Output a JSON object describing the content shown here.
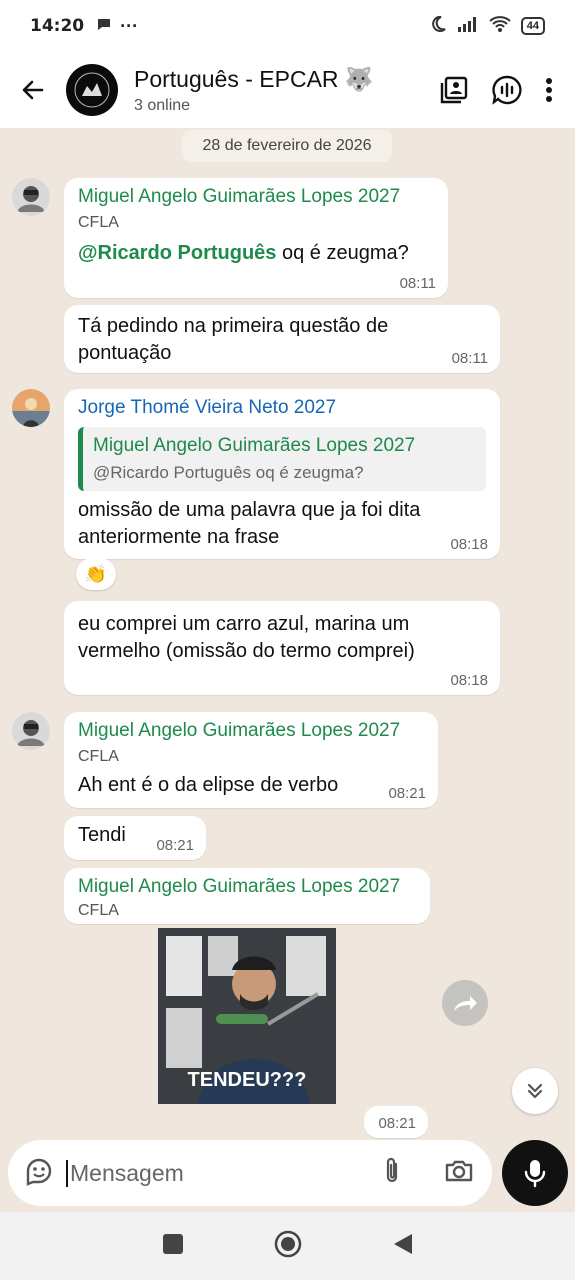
{
  "status_bar": {
    "time": "14:20",
    "battery": "44"
  },
  "header": {
    "title": "Português - EPCAR 🐺",
    "subtitle": "3 online"
  },
  "date_chip": "28 de fevereiro de 2026",
  "messages": [
    {
      "sender": "Miguel Angelo Guimarães Lopes 2027",
      "tag": "CFLA",
      "mention": "@Ricardo Português",
      "text": " oq é zeugma?",
      "time": "08:11"
    },
    {
      "text_line1": "Tá pedindo na primeira questão de",
      "text_line2": "pontuação",
      "time": "08:11"
    },
    {
      "sender": "Jorge Thomé Vieira Neto 2027",
      "quote_name": "Miguel Angelo Guimarães Lopes 2027",
      "quote_text": "@Ricardo Português oq é zeugma?",
      "text_line1": "omissão de uma palavra que ja foi dita",
      "text_line2": "anteriormente na frase",
      "time": "08:18",
      "reaction": "👏"
    },
    {
      "text_line1": "eu comprei um carro azul, marina um",
      "text_line2": "vermelho (omissão do termo comprei)",
      "time": "08:18"
    },
    {
      "sender": "Miguel Angelo Guimarães Lopes 2027",
      "tag": "CFLA",
      "text": "Ah ent é o da elipse de verbo",
      "time": "08:21"
    },
    {
      "text": "Tendi",
      "time": "08:21"
    },
    {
      "sender": "Miguel Angelo Guimarães Lopes 2027",
      "tag": "CFLA"
    },
    {
      "video_caption": "TENDEU???",
      "time": "08:21"
    }
  ],
  "composer": {
    "placeholder": "Mensagem"
  },
  "colors": {
    "sender_green": "#1e8a4c",
    "sender_blue": "#1766b5",
    "chat_bg": "#efe7dd"
  }
}
